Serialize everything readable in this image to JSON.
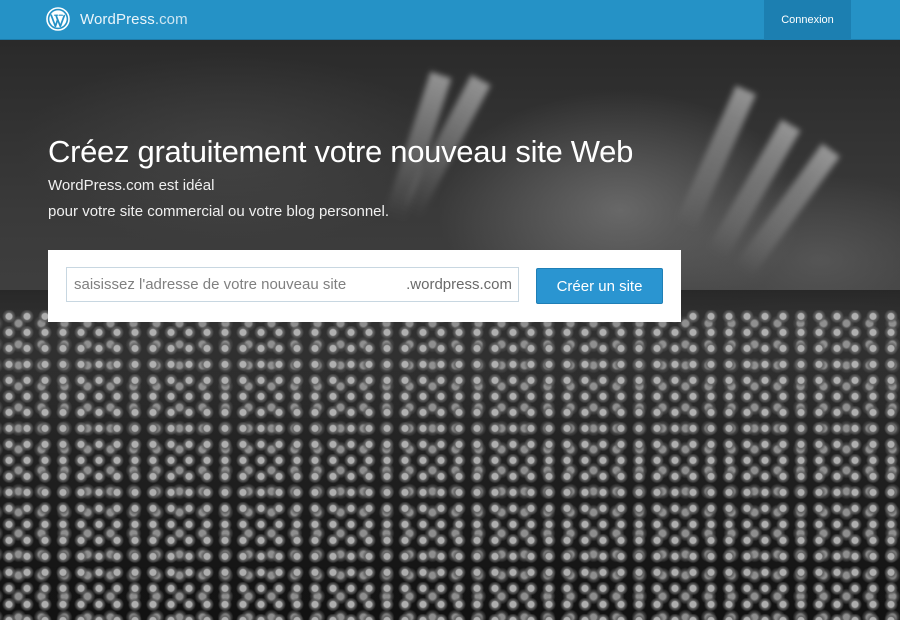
{
  "header": {
    "logo_icon": "wordpress-logo-icon",
    "brand": "WordPress",
    "brand_suffix": ".com",
    "login_label": "Connexion",
    "colors": {
      "bar": "#2592c6",
      "login_bg": "#1c7fb1"
    }
  },
  "hero": {
    "title": "Créez gratuitement votre nouveau site Web",
    "subtitle_line1": "WordPress.com est idéal",
    "subtitle_line2": "pour votre site commercial ou votre blog personnel.",
    "background": "concert crowd photo (grayscale)"
  },
  "signup": {
    "address_placeholder": "saisissez l'adresse de votre nouveau site",
    "address_value": "",
    "domain_suffix": ".wordpress.com",
    "create_label": "Créer un site",
    "colors": {
      "button": "#2a95d1"
    }
  }
}
